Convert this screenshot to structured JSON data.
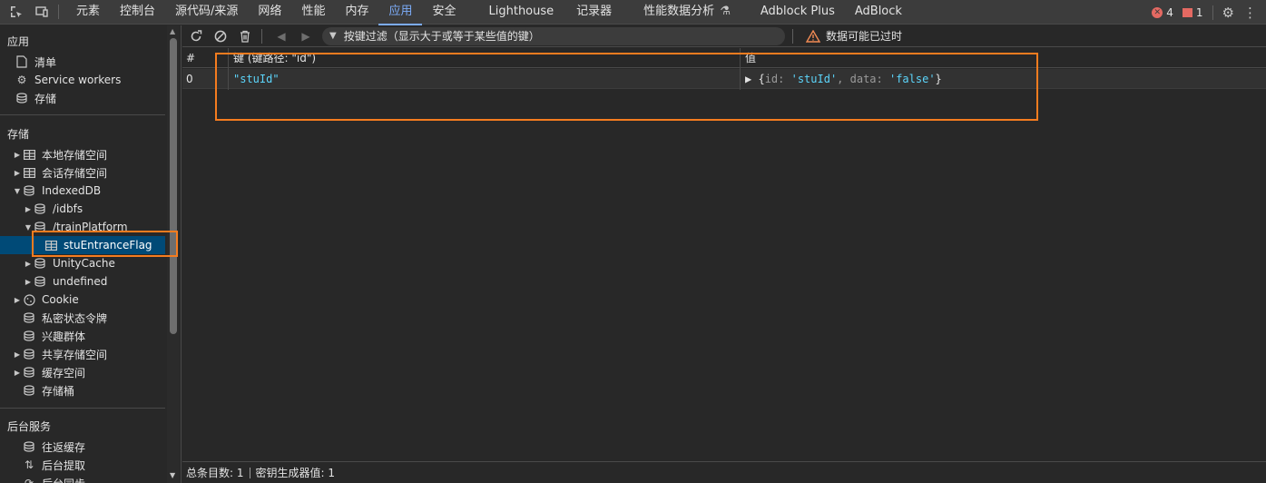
{
  "topbar": {
    "tabs": [
      "元素",
      "控制台",
      "源代码/来源",
      "网络",
      "性能",
      "内存",
      "应用",
      "安全",
      "Lighthouse",
      "记录器",
      "性能数据分析",
      "Adblock Plus",
      "AdBlock"
    ],
    "active_tab": "应用",
    "errors": "4",
    "issues": "1"
  },
  "sidebar": {
    "app_title": "应用",
    "app_items": [
      "清单",
      "Service workers",
      "存储"
    ],
    "storage_title": "存储",
    "storage_items": {
      "local": "本地存储空间",
      "session": "会话存储空间",
      "indexeddb": "IndexedDB",
      "idbfs": "/idbfs",
      "train": "/trainPlatform",
      "store": "stuEntranceFlag",
      "unity": "UnityCache",
      "undefined": "undefined",
      "cookie": "Cookie",
      "private_token": "私密状态令牌",
      "interest": "兴趣群体",
      "shared": "共享存储空间",
      "cache": "缓存空间",
      "bucket": "存储桶"
    },
    "bg_title": "后台服务",
    "bg_items": [
      "往返缓存",
      "后台提取",
      "后台同步"
    ]
  },
  "toolbar": {
    "filter_placeholder": "按键过滤（显示大于或等于某些值的键）",
    "warning": "数据可能已过时"
  },
  "grid": {
    "headers": [
      "#",
      "键 (键路径: \"id\")",
      "值"
    ],
    "rows": [
      {
        "index": "0",
        "key": "\"stuId\"",
        "value_prefix": "▶ {",
        "value_k1": "id: ",
        "value_v1": "'stuId'",
        "value_k2": ", data: ",
        "value_v2": "'false'",
        "value_suffix": "}"
      }
    ]
  },
  "status": {
    "total": "总条目数: 1",
    "keygen": "密钥生成器值: 1"
  },
  "colors": {
    "accent": "#7cacf8",
    "highlight": "#f57c1f",
    "selected_bg": "#004a77",
    "error": "#e46962",
    "string": "#5cd5fb"
  }
}
